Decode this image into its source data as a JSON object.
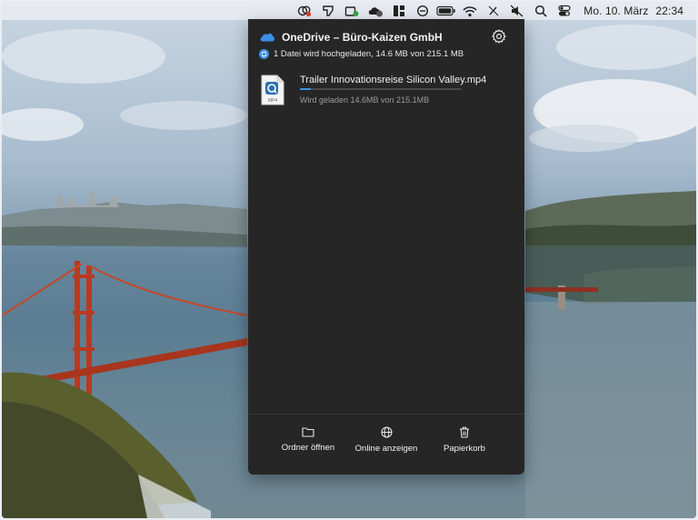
{
  "menubar": {
    "icons": [
      "creative-cloud-icon",
      "pen-tool-icon",
      "package-icon",
      "cloud-sync-icon",
      "layout-icon",
      "history-icon",
      "battery-icon",
      "wifi-icon",
      "pen-off-icon",
      "volume-muted-icon",
      "search-icon",
      "control-center-icon"
    ],
    "date": "Mo. 10. März",
    "time": "22:34"
  },
  "onedrive": {
    "title": "OneDrive – Büro-Kaizen GmbH",
    "status": "1 Datei wird hochgeladen, 14.6 MB von 215.1 MB",
    "accent": "#3b8ee8",
    "file": {
      "name": "Trailer Innovationsreise Silicon Valley.mp4",
      "type_label": "MP4",
      "progress": 0.068,
      "status": "Wird geladen 14.6MB von 215.1MB"
    },
    "actions": {
      "open_folder": "Ordner öffnen",
      "view_online": "Online anzeigen",
      "recycle_bin": "Papierkorb"
    }
  }
}
